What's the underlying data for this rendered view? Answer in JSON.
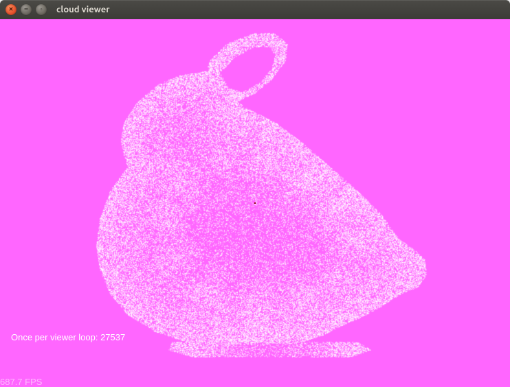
{
  "window": {
    "title": "cloud viewer"
  },
  "viewport": {
    "background_color": "#ff66ff",
    "status_prefix": "Once per viewer loop: ",
    "loop_count": "27537",
    "fps_value": "687.7",
    "fps_suffix": " FPS",
    "point_color": "#ffffff"
  },
  "icons": {
    "close": "close-icon",
    "minimize": "minimize-icon",
    "maximize": "maximize-icon"
  }
}
